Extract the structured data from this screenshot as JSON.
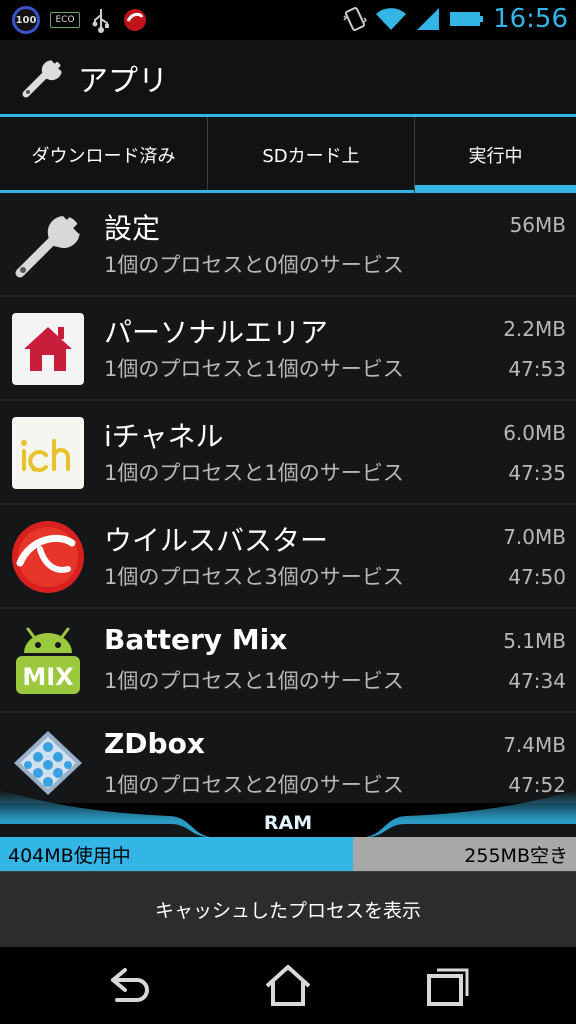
{
  "status_bar": {
    "badge_100": "100",
    "eco_label": "ECO",
    "time": "16:56",
    "icons": [
      "usb-icon",
      "antivirus-icon",
      "vibrate-icon",
      "wifi-icon",
      "signal-icon",
      "battery-icon"
    ]
  },
  "action_bar": {
    "title": "アプリ",
    "icon": "wrench-icon"
  },
  "tabs": [
    {
      "label": "ダウンロード済み"
    },
    {
      "label": "SDカード上"
    },
    {
      "label": "実行中",
      "selected": true
    }
  ],
  "apps": [
    {
      "name": "設定",
      "sub": "1個のプロセスと0個のサービス",
      "size": "56MB",
      "time": "",
      "icon": "settings-wrench-icon"
    },
    {
      "name": "パーソナルエリア",
      "sub": "1個のプロセスと1個のサービス",
      "size": "2.2MB",
      "time": "47:53",
      "icon": "home-icon"
    },
    {
      "name": "iチャネル",
      "sub": "1個のプロセスと1個のサービス",
      "size": "6.0MB",
      "time": "47:35",
      "icon": "ichannel-icon"
    },
    {
      "name": "ウイルスバスター",
      "sub": "1個のプロセスと3個のサービス",
      "size": "7.0MB",
      "time": "47:50",
      "icon": "virusbuster-icon"
    },
    {
      "name": "Battery Mix",
      "sub": "1個のプロセスと1個のサービス",
      "size": "5.1MB",
      "time": "47:34",
      "icon": "battery-mix-icon"
    },
    {
      "name": "ZDbox",
      "sub": "1個のプロセスと2個のサービス",
      "size": "7.4MB",
      "time": "47:52",
      "icon": "zdbox-icon"
    }
  ],
  "ram": {
    "label": "RAM",
    "used": "404MB使用中",
    "free": "255MB空き",
    "used_fraction": 0.613
  },
  "cached_button": "キャッシュしたプロセスを表示",
  "nav": {
    "icons": [
      "back-icon",
      "home-nav-icon",
      "recent-apps-icon"
    ]
  },
  "colors": {
    "accent": "#33b5e5",
    "background": "#141618"
  }
}
